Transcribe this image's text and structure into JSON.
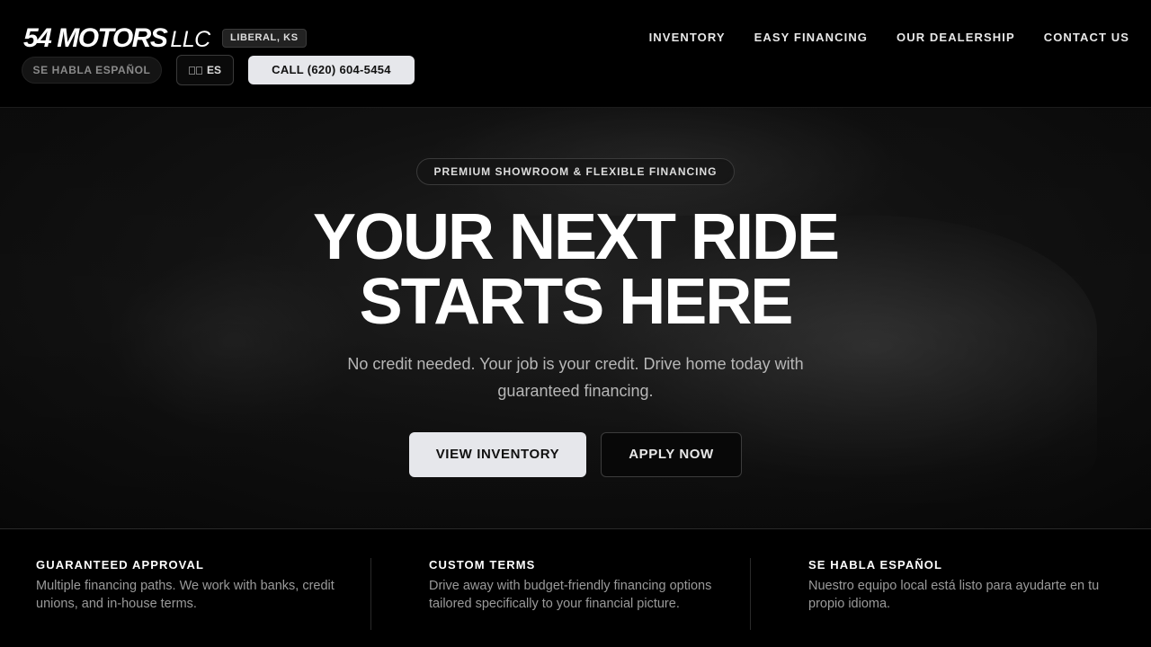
{
  "header": {
    "logo_main": "54 MOTORS",
    "logo_suffix": "LLC",
    "location_badge": "LIBERAL, KS",
    "spanish_pill": "SE HABLA ESPAÑOL",
    "lang_toggle": "ES",
    "call_button": "CALL (620) 604-5454",
    "nav": [
      {
        "label": "INVENTORY"
      },
      {
        "label": "EASY FINANCING"
      },
      {
        "label": "OUR DEALERSHIP"
      },
      {
        "label": "CONTACT US"
      }
    ]
  },
  "hero": {
    "tagline": "PREMIUM SHOWROOM & FLEXIBLE FINANCING",
    "headline_line1": "YOUR NEXT RIDE",
    "headline_line2": "STARTS HERE",
    "subtext": "No credit needed. Your job is your credit. Drive home today with guaranteed financing.",
    "primary_button": "VIEW INVENTORY",
    "secondary_button": "APPLY NOW"
  },
  "features": [
    {
      "title": "GUARANTEED APPROVAL",
      "text": "Multiple financing paths. We work with banks, credit unions, and in-house terms."
    },
    {
      "title": "CUSTOM TERMS",
      "text": "Drive away with budget-friendly financing options tailored specifically to your financial picture."
    },
    {
      "title": "SE HABLA ESPAÑOL",
      "text": "Nuestro equipo local está listo para ayudarte en tu propio idioma."
    }
  ],
  "colors": {
    "background": "#000000",
    "light_button": "#e6e7eb",
    "muted_text": "#9a9a9a"
  }
}
